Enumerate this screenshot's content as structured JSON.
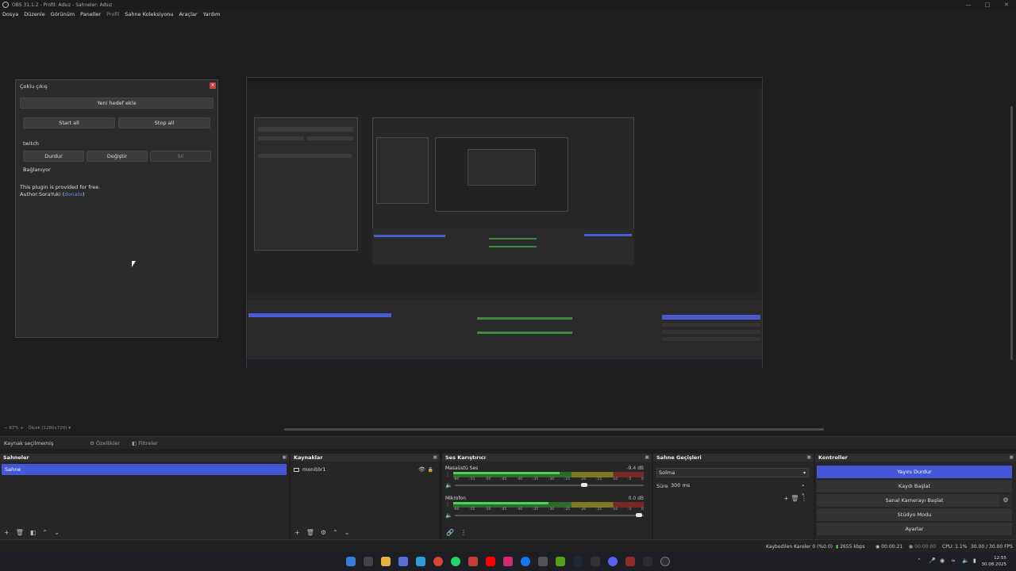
{
  "window": {
    "title": "OBS 31.1.2 - Profil: Adsız - Sahneler: Adsız"
  },
  "menu": [
    "Dosya",
    "Düzenle",
    "Görünüm",
    "Paneller",
    "Profil",
    "Sahne Koleksiyonu",
    "Araçlar",
    "Yardım"
  ],
  "dialog": {
    "title": "Çoklu çıkış",
    "add_target": "Yeni hedef ekle",
    "start_all": "Start all",
    "stop_all": "Stop all",
    "target_name": "twitch",
    "stop": "Durdur",
    "edit": "Değiştir",
    "delete": "Sil",
    "status": "Bağlanıyor",
    "info_line1": "This plugin is provided for free.",
    "info_author": "Author:SoraYuki (",
    "info_link": "donate",
    "info_close": ")"
  },
  "preview_status": {
    "zoom": "67%",
    "canvas": "Ölçek (1280x720)"
  },
  "source_toolbar": {
    "no_source": "Kaynak seçilmemiş",
    "properties": "Özellikler",
    "filters": "Filtreler"
  },
  "docks": {
    "scenes": {
      "title": "Sahneler",
      "items": [
        "Sahne"
      ]
    },
    "sources": {
      "title": "Kaynaklar",
      "items": [
        "monitör1"
      ]
    },
    "mixer": {
      "title": "Ses Karıştırıcı",
      "channels": [
        {
          "name": "Masaüstü Ses",
          "db": "-9.4 dB",
          "level": 0.56,
          "volume": 0.7
        },
        {
          "name": "Mikrofon",
          "db": "0.0 dB",
          "level": 0.5,
          "volume": 0.99
        }
      ],
      "ticks": [
        "-60",
        "-55",
        "-50",
        "-45",
        "-40",
        "-35",
        "-30",
        "-25",
        "-20",
        "-15",
        "-10",
        "-5",
        "0"
      ]
    },
    "transitions": {
      "title": "Sahne Geçişleri",
      "selected": "Solma",
      "duration_label": "Süre",
      "duration": "300 ms"
    },
    "controls": {
      "title": "Kontroller",
      "buttons": [
        "Yayını Durdur",
        "Kaydı Başlat",
        "Sanal Kamerayı Başlat",
        "Stüdyo Modu",
        "Ayarlar"
      ]
    }
  },
  "stats": {
    "dropped": "Kaybedilen Kareler 0 (%0.0)",
    "bitrate": "2655 kbps",
    "stream_time": "00:00:21",
    "rec_time": "00:00:00",
    "cpu": "CPU: 1.1%",
    "fps": "30.00 / 30.00 FPS"
  },
  "clock": {
    "time": "12:55",
    "date": "30.08.2025"
  },
  "colors": {
    "accent": "#4357d8",
    "close": "#c94040"
  }
}
